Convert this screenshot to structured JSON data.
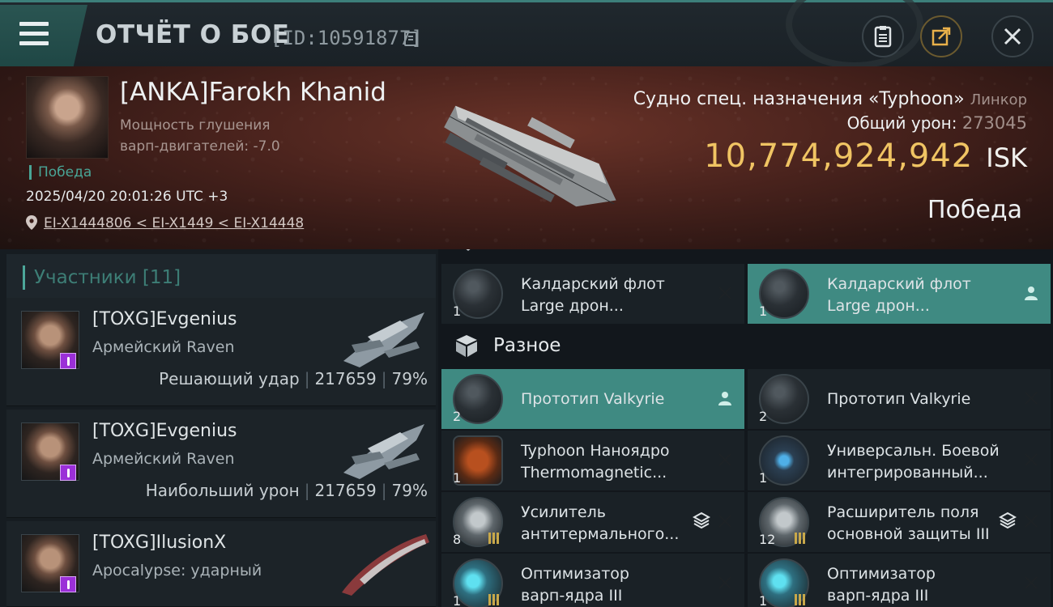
{
  "header": {
    "title": "ОТЧЁТ О БОЕ",
    "battle_id": "[ID:10591877]",
    "icons": [
      "menu-icon",
      "copy-icon",
      "clipboard-icon",
      "share-icon",
      "close-icon"
    ]
  },
  "victim": {
    "name": "[ANKA]Farokh Khanid",
    "attribute_line1": "Мощность глушения",
    "attribute_line2": "варп-двигателей: -7.0",
    "status_small": "Победа",
    "datetime": "2025/04/20 20:01:26 UTC +3",
    "route": "EI-X1444806 < EI-X1449 < EI-X14448",
    "ship_type": "Судно спец. назначения «Typhoon»",
    "ship_class": "Линкор",
    "total_damage_label": "Общий урон:",
    "total_damage": "273045",
    "isk_value": "10,774,924,942",
    "isk_unit": "ISK",
    "status_big": "Победа"
  },
  "participants": {
    "header": "Участники [11]",
    "items": [
      {
        "name": "[TOXG]Evgenius",
        "ship": "Армейский Raven",
        "role": "Решающий удар",
        "damage": "217659",
        "percent": "79%"
      },
      {
        "name": "[TOXG]Evgenius",
        "ship": "Армейский Raven",
        "role": "Наибольший урон",
        "damage": "217659",
        "percent": "79%"
      },
      {
        "name": "[TOXG]IlusionX",
        "ship": "Apocalypse: ударный",
        "role": "",
        "damage": "",
        "percent": ""
      }
    ]
  },
  "modules": {
    "section_misc": "Разное",
    "rows": [
      [
        {
          "name1": "Калдарский флот",
          "name2": "Large дрон...",
          "qty": "1"
        },
        {
          "name1": "Калдарский флот",
          "name2": "Large дрон...",
          "qty": "1"
        }
      ],
      [
        {
          "name1": "Прототип Valkyrie",
          "name2": "",
          "qty": "2"
        },
        {
          "name1": "Прототип Valkyrie",
          "name2": "",
          "qty": "2"
        }
      ],
      [
        {
          "name1": "Typhoon Наноядро",
          "name2": "Thermomagnetic...",
          "qty": "1"
        },
        {
          "name1": "Универсальн. Боевой",
          "name2": " интегрированный...",
          "qty": "1"
        }
      ],
      [
        {
          "name1": "Усилитель",
          "name2": "антитермального...",
          "qty": "8"
        },
        {
          "name1": "Расширитель поля",
          "name2": "основной защиты III",
          "qty": "12"
        }
      ],
      [
        {
          "name1": "Оптимизатор",
          "name2": "варп-ядра III",
          "qty": "1"
        },
        {
          "name1": "Оптимизатор",
          "name2": "варп-ядра III",
          "qty": "1"
        }
      ]
    ]
  },
  "colors": {
    "accent": "#3f8a82",
    "isk_gold": "#f0c463",
    "banner_red": "#4a231d",
    "badge_purple": "#9b2fd8"
  }
}
